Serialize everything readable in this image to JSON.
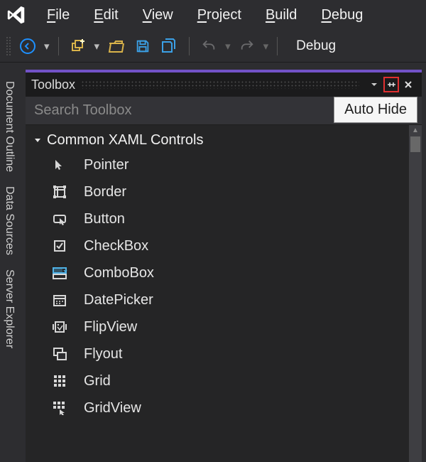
{
  "menu": {
    "items": [
      {
        "label": "File",
        "mn": "F"
      },
      {
        "label": "Edit",
        "mn": "E"
      },
      {
        "label": "View",
        "mn": "V"
      },
      {
        "label": "Project",
        "mn": "P"
      },
      {
        "label": "Build",
        "mn": "B"
      },
      {
        "label": "Debug",
        "mn": "D"
      }
    ]
  },
  "toolbar": {
    "config_label": "Debug"
  },
  "side_tabs": [
    "Document Outline",
    "Data Sources",
    "Server Explorer"
  ],
  "toolbox": {
    "title": "Toolbox",
    "search_placeholder": "Search Toolbox",
    "tooltip": "Auto Hide",
    "category": "Common XAML Controls",
    "items": [
      {
        "name": "Pointer",
        "icon": "pointer-icon"
      },
      {
        "name": "Border",
        "icon": "border-icon"
      },
      {
        "name": "Button",
        "icon": "button-icon"
      },
      {
        "name": "CheckBox",
        "icon": "checkbox-icon"
      },
      {
        "name": "ComboBox",
        "icon": "combobox-icon"
      },
      {
        "name": "DatePicker",
        "icon": "datepicker-icon"
      },
      {
        "name": "FlipView",
        "icon": "flipview-icon"
      },
      {
        "name": "Flyout",
        "icon": "flyout-icon"
      },
      {
        "name": "Grid",
        "icon": "grid-icon"
      },
      {
        "name": "GridView",
        "icon": "gridview-icon"
      }
    ]
  },
  "colors": {
    "accent": "#7252c7",
    "highlight": "#e03030",
    "panel_bg": "#252526"
  }
}
